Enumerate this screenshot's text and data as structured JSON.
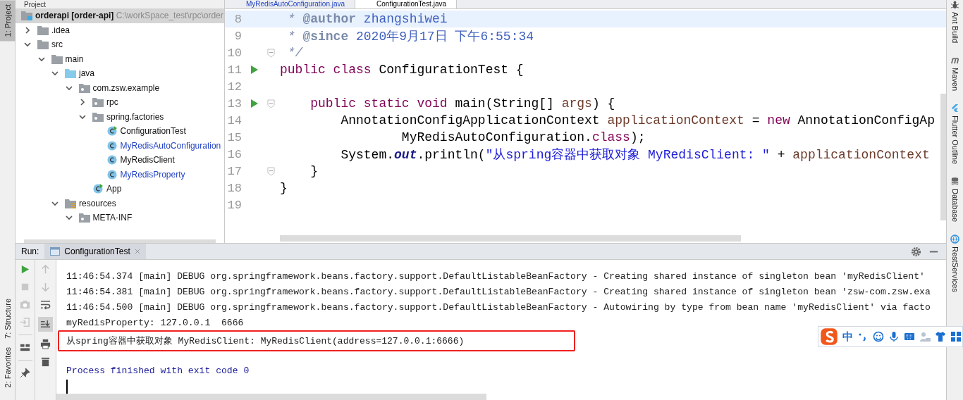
{
  "left_tool_strip": [
    {
      "label": "1: Project",
      "selected": true
    },
    {
      "label": "7: Structure",
      "selected": false
    },
    {
      "label": "2: Favorites",
      "selected": false
    }
  ],
  "project_panel": {
    "title": "Project",
    "root": {
      "name": "orderapi",
      "module": "[order-api]",
      "path": "C:\\workSpace_test\\rpc\\order",
      "selected": true
    },
    "tree": [
      {
        "label": ".idea",
        "kind": "folder",
        "expanded": false
      },
      {
        "label": "src",
        "kind": "folder",
        "expanded": true,
        "children": [
          {
            "label": "main",
            "kind": "folder",
            "expanded": true,
            "children": [
              {
                "label": "java",
                "kind": "source-folder",
                "expanded": true,
                "children": [
                  {
                    "label": "com.zsw.example",
                    "kind": "package",
                    "expanded": true,
                    "children": [
                      {
                        "label": "rpc",
                        "kind": "package",
                        "expanded": false
                      },
                      {
                        "label": "spring.factories",
                        "kind": "package",
                        "expanded": true,
                        "children": [
                          {
                            "label": "ConfigurationTest",
                            "kind": "class",
                            "runnable": true,
                            "modified": false
                          },
                          {
                            "label": "MyRedisAutoConfiguration",
                            "kind": "class",
                            "runnable": false,
                            "modified": true
                          },
                          {
                            "label": "MyRedisClient",
                            "kind": "class",
                            "runnable": false,
                            "modified": false
                          },
                          {
                            "label": "MyRedisProperty",
                            "kind": "class",
                            "runnable": false,
                            "modified": true
                          }
                        ]
                      },
                      {
                        "label": "App",
                        "kind": "class",
                        "runnable": true,
                        "modified": false
                      }
                    ]
                  }
                ]
              },
              {
                "label": "resources",
                "kind": "resources",
                "expanded": true,
                "children": [
                  {
                    "label": "META-INF",
                    "kind": "package",
                    "expanded": true
                  }
                ]
              }
            ]
          }
        ]
      }
    ]
  },
  "editor": {
    "tabs": [
      {
        "label": "MyRedisAutoConfiguration.java",
        "selected": false,
        "modified": true
      },
      {
        "label": "ConfigurationTest.java",
        "selected": true,
        "modified": false
      }
    ],
    "lines": [
      {
        "number": "8",
        "current": true,
        "run": false,
        "fold": false,
        "tokens": [
          {
            "text": " * ",
            "kind": "doc"
          },
          {
            "text": "@author",
            "kind": "doctag"
          },
          {
            "text": " zhangshiwei",
            "kind": "docval"
          }
        ]
      },
      {
        "number": "9",
        "current": false,
        "run": false,
        "fold": false,
        "tokens": [
          {
            "text": " * ",
            "kind": "doc"
          },
          {
            "text": "@since",
            "kind": "doctag"
          },
          {
            "text": " 2020年9月17日 下午6:55:34",
            "kind": "docval"
          }
        ]
      },
      {
        "number": "10",
        "current": false,
        "run": false,
        "fold": true,
        "tokens": [
          {
            "text": " */",
            "kind": "doc"
          }
        ]
      },
      {
        "number": "11",
        "current": false,
        "run": true,
        "fold": false,
        "tokens": [
          {
            "text": "public class",
            "kind": "kw"
          },
          {
            "text": " ConfigurationTest {",
            "kind": "plain"
          }
        ]
      },
      {
        "number": "12",
        "current": false,
        "run": false,
        "fold": false
      },
      {
        "number": "13",
        "current": false,
        "run": true,
        "fold": true,
        "tokens": [
          {
            "text": "    public static void",
            "kind": "kw"
          },
          {
            "text": " main(String[] ",
            "kind": "plain"
          },
          {
            "text": "args",
            "kind": "var"
          },
          {
            "text": ") {",
            "kind": "plain"
          }
        ]
      },
      {
        "number": "14",
        "current": false,
        "run": false,
        "fold": false,
        "tokens": [
          {
            "text": "        AnnotationConfigApplicationContext ",
            "kind": "plain"
          },
          {
            "text": "applicationContext",
            "kind": "var"
          },
          {
            "text": " = ",
            "kind": "plain"
          },
          {
            "text": "new",
            "kind": "kw"
          },
          {
            "text": " AnnotationConfigAp",
            "kind": "plain"
          }
        ]
      },
      {
        "number": "15",
        "current": false,
        "run": false,
        "fold": false,
        "tokens": [
          {
            "text": "                MyRedisAutoConfiguration.",
            "kind": "plain"
          },
          {
            "text": "class",
            "kind": "kw"
          },
          {
            "text": ");",
            "kind": "plain"
          }
        ]
      },
      {
        "number": "16",
        "current": false,
        "run": false,
        "fold": false,
        "tokens": [
          {
            "text": "        System.",
            "kind": "plain"
          },
          {
            "text": "out",
            "kind": "field"
          },
          {
            "text": ".println(",
            "kind": "plain"
          },
          {
            "text": "\"从spring容器中获取对象 MyRedisClient: \"",
            "kind": "string"
          },
          {
            "text": " + ",
            "kind": "plain"
          },
          {
            "text": "applicationContext",
            "kind": "var"
          }
        ]
      },
      {
        "number": "17",
        "current": false,
        "run": false,
        "fold": true,
        "tokens": [
          {
            "text": "    }",
            "kind": "plain"
          }
        ]
      },
      {
        "number": "18",
        "current": false,
        "run": false,
        "fold": false,
        "tokens": [
          {
            "text": "}",
            "kind": "plain"
          }
        ]
      },
      {
        "number": "19",
        "current": false,
        "run": false,
        "fold": false
      }
    ]
  },
  "run_panel": {
    "label": "Run:",
    "tabs": [
      {
        "label": "ConfigurationTest",
        "selected": true
      }
    ],
    "console": [
      {
        "text": "11:46:54.374 [main] DEBUG org.springframework.beans.factory.support.DefaultListableBeanFactory - Creating shared instance of singleton bean 'myRedisClient'",
        "kind": "log",
        "highlighted": false
      },
      {
        "text": "11:46:54.381 [main] DEBUG org.springframework.beans.factory.support.DefaultListableBeanFactory - Creating shared instance of singleton bean 'zsw-com.zsw.exa",
        "kind": "log",
        "highlighted": false
      },
      {
        "text": "11:46:54.500 [main] DEBUG org.springframework.beans.factory.support.DefaultListableBeanFactory - Autowiring by type from bean name 'myRedisClient' via facto",
        "kind": "log",
        "highlighted": false
      },
      {
        "text": "myRedisProperty: 127.0.0.1  6666",
        "kind": "output",
        "highlighted": false
      },
      {
        "text": "从spring容器中获取对象 MyRedisClient: MyRedisClient(address=127.0.0.1:6666)",
        "kind": "output",
        "highlighted": true
      },
      {
        "text": "Process finished with exit code 0",
        "kind": "system",
        "highlighted": false
      }
    ]
  },
  "right_tool_strip": [
    {
      "label": "Ant Build",
      "kind": "ant"
    },
    {
      "label": "Maven",
      "kind": "maven"
    },
    {
      "label": "Flutter Outline",
      "kind": "flutter"
    },
    {
      "label": "Database",
      "kind": "database"
    },
    {
      "label": "RestServices",
      "kind": "rest"
    }
  ],
  "ime_toolbar": {
    "mode": "中"
  }
}
